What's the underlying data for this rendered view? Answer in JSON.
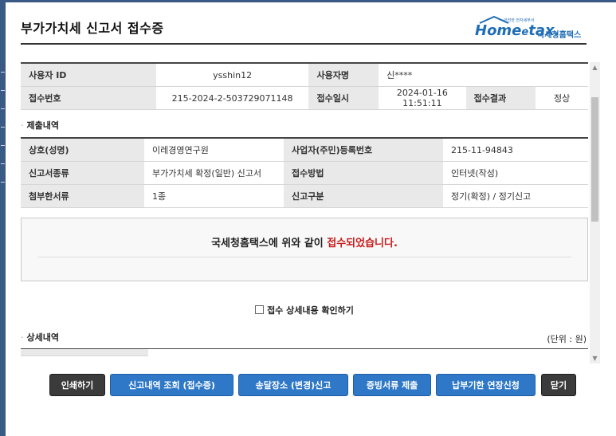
{
  "page": {
    "title": "부가가치세 신고서 접수증",
    "logo": {
      "main": "Home",
      "e": "e",
      "tax": "tax.",
      "kr": "국세청홈택스",
      "tiny": "안전한 전자세무서"
    }
  },
  "summary": {
    "user_id_label": "사용자 ID",
    "user_id": "ysshin12",
    "user_name_label": "사용자명",
    "user_name": "신****",
    "receipt_no_label": "접수번호",
    "receipt_no": "215-2024-2-503729071148",
    "receipt_date_label": "접수일시",
    "receipt_date": "2024-01-16 11:51:11",
    "result_label": "접수결과",
    "result": "정상"
  },
  "submission": {
    "section_label": "제출내역",
    "trade_name_label": "상호(성명)",
    "trade_name": "이레경영연구원",
    "biz_no_label": "사업자(주민)등록번호",
    "biz_no": "215-11-94843",
    "form_type_label": "신고서종류",
    "form_type": "부가가치세 확정(일반) 신고서",
    "method_label": "접수방법",
    "method": "인터넷(작성)",
    "attach_label": "첨부한서류",
    "attach": "1종",
    "category_label": "신고구분",
    "category": "정기(확정) / 정기신고"
  },
  "notice": {
    "prefix": "국세청홈택스에 위와 같이 ",
    "highlight": "접수되었습니다."
  },
  "check": {
    "label": "접수 상세내용 확인하기",
    "checked": false
  },
  "detail": {
    "section_label": "상세내역",
    "unit": "(단위 : 원)"
  },
  "buttons": {
    "print": "인쇄하기",
    "history": "신고내역 조회 (접수증)",
    "address": "송달장소 (변경)신고",
    "evidence": "증빙서류 제출",
    "extension": "납부기한 연장신청",
    "close": "닫기"
  },
  "colors": {
    "accent": "#2e78c7",
    "dark_button": "#3b3b3b",
    "highlight": "#c81a1a",
    "frame": "#3a5a86"
  }
}
